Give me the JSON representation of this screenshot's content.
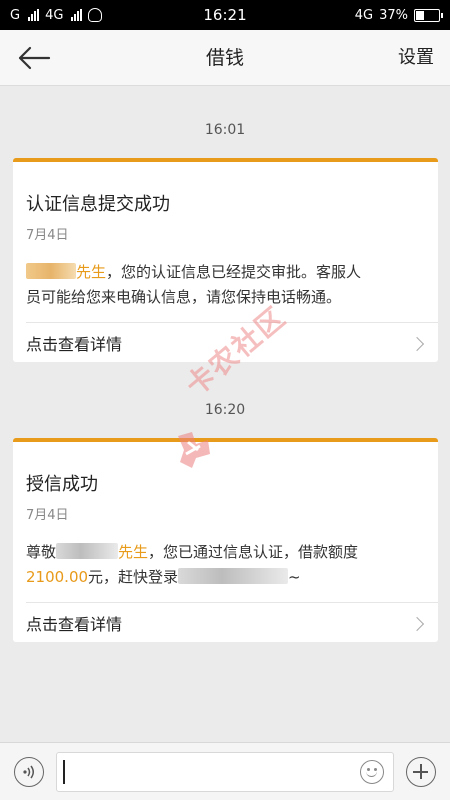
{
  "status_bar": {
    "carrier_left": "G",
    "carrier_second": "4G",
    "time": "16:21",
    "network": "4G",
    "battery_percent_text": "37%",
    "battery_level": 0.37
  },
  "header": {
    "title": "借钱",
    "settings_label": "设置"
  },
  "messages": [
    {
      "time": "16:01",
      "title": "认证信息提交成功",
      "date": "7月4日",
      "body_suffix_name": "先生",
      "body_text_1": "，您的认证信息已经提交审批。客服人",
      "body_text_2": "员可能给您来电确认信息，请您保持电话畅通。",
      "detail_label": "点击查看详情"
    },
    {
      "time": "16:20",
      "title": "授信成功",
      "date": "7月4日",
      "body_prefix": "尊敬",
      "body_suffix_name": "先生",
      "body_text_1": "，您已通过信息认证，借款额度",
      "amount": "2100.00",
      "body_text_2": "元，赶快登录",
      "body_text_3": "~",
      "detail_label": "点击查看详情"
    }
  ],
  "watermark": {
    "text": "卡农社区"
  },
  "input_bar": {
    "placeholder": ""
  },
  "colors": {
    "accent": "#e89a1a",
    "background": "#ebebeb",
    "card": "#ffffff"
  }
}
